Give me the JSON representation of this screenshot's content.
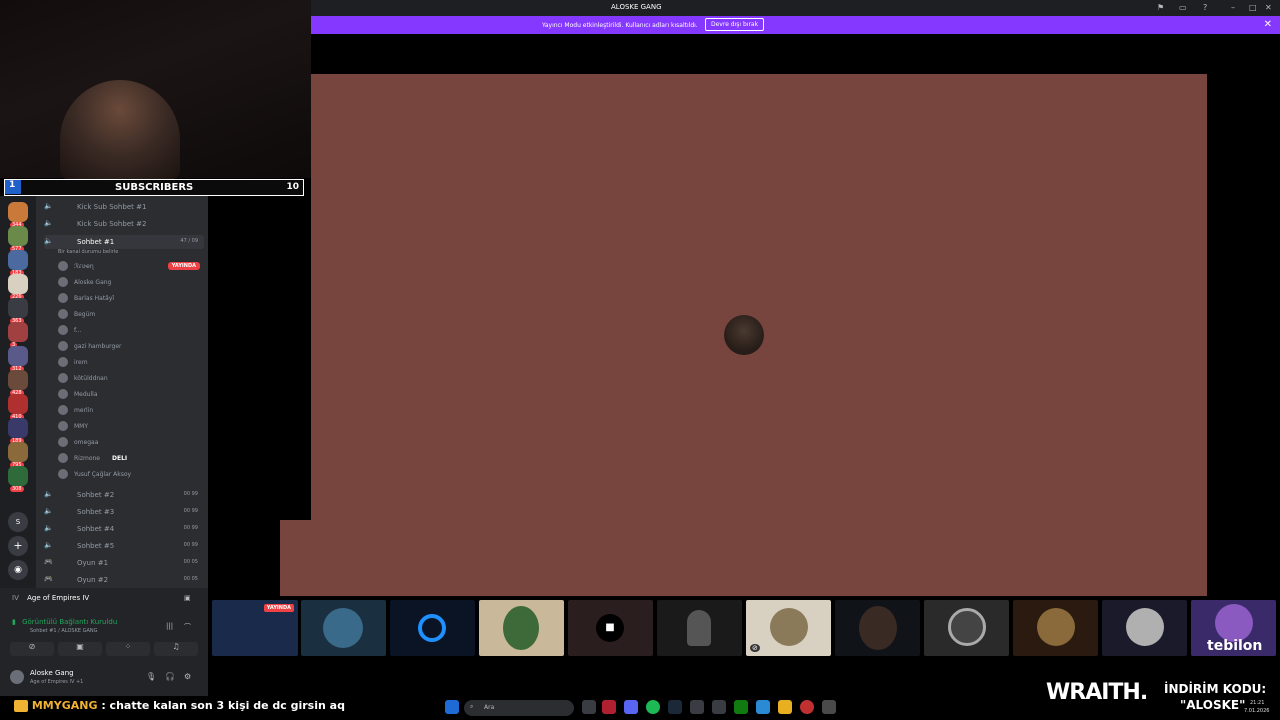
{
  "window": {
    "title": "ALOSKE GANG",
    "controls": [
      "–",
      "□",
      "✕"
    ]
  },
  "banner": {
    "message": "Yayıncı Modu etkinleştirildi. Kullanıcı adları kısaltıldı.",
    "button": "Devre dışı bırak",
    "close": "✕"
  },
  "overlay": {
    "subscribers_label": "SUBSCRIBERS",
    "left_count": "1",
    "right_count": "10"
  },
  "channels": [
    {
      "name": "Kick Sub Sohbet #1",
      "icon": "speaker-icon",
      "tag": ""
    },
    {
      "name": "Kick Sub Sohbet #2",
      "icon": "speaker-icon",
      "tag": ""
    },
    {
      "name": "Sohbet #1",
      "icon": "speaker-icon",
      "tag": "47 / 09",
      "status": "Bir kanal durumu belirle"
    }
  ],
  "members": [
    {
      "name": "ℛɾʋҽɳ",
      "live": "YAYINDA"
    },
    {
      "name": "Aloske Gang"
    },
    {
      "name": "Barlas Hatâyî"
    },
    {
      "name": "Begüm"
    },
    {
      "name": "f..."
    },
    {
      "name": "gazi hamburger"
    },
    {
      "name": "irem"
    },
    {
      "name": "kötülddnan"
    },
    {
      "name": "Medulla"
    },
    {
      "name": "merlin"
    },
    {
      "name": "MMY"
    },
    {
      "name": "omegaa"
    },
    {
      "name": "Rizmone",
      "tag": "DELI"
    },
    {
      "name": "Yusuf Çağlar Aksoy"
    }
  ],
  "more_channels": [
    {
      "name": "Sohbet #2",
      "tag": "00 99"
    },
    {
      "name": "Sohbet #3",
      "tag": "00 99"
    },
    {
      "name": "Sohbet #4",
      "tag": "00 99"
    },
    {
      "name": "Sohbet #5",
      "tag": "00 99"
    },
    {
      "name": "Oyun #1",
      "tag": "00 05"
    },
    {
      "name": "Oyun #2",
      "tag": "00 05"
    }
  ],
  "server_badges": [
    "344",
    "577",
    "183",
    "226",
    "363",
    "3",
    "312",
    "428",
    "410",
    "189",
    "795",
    "308"
  ],
  "server_letter": "S",
  "activity": {
    "game": "Age of Empires IV"
  },
  "voice": {
    "status": "Görüntülü Bağlantı Kuruldu",
    "channel": "Sohbet #1 / ALOSKE GANG"
  },
  "user": {
    "name": "Aloske Gang",
    "activity": "Age of Empires IV +1"
  },
  "thumb_live": "YAYINDA",
  "taskbar": {
    "search_placeholder": "Ara",
    "time": "21:21",
    "date": "7.01.2026"
  },
  "chat": {
    "user": "MMYGANG",
    "message": ": chatte kalan son 3 kişi de dc girsin aq"
  },
  "sponsor": {
    "brand": "WRAITH.",
    "line1": "İNDİRİM KODU:",
    "code": "\"ALOSKE\"",
    "logo": "tebilon"
  },
  "colors": {
    "accent": "#8538ff",
    "stream_bg": "#77453d",
    "live_red": "#ed4245",
    "subs_blue": "#1f61c9"
  }
}
